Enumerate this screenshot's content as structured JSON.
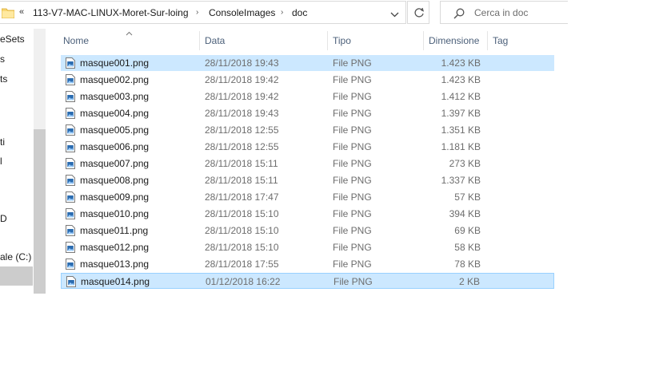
{
  "address": {
    "more": "«",
    "crumbs": [
      "113-V7-MAC-LINUX-Moret-Sur-loing",
      "ConsoleImages",
      "doc"
    ],
    "folder_icon": "folder-icon",
    "dropdown_icon": "chevron-down-icon",
    "refresh_icon": "refresh-icon"
  },
  "search": {
    "placeholder": "Cerca in doc",
    "icon": "search-icon"
  },
  "nav": {
    "items": [
      "eSets",
      "s",
      "ts",
      "ti",
      "l",
      "D",
      "ale (C:)"
    ]
  },
  "columns": {
    "name": "Nome",
    "date": "Data",
    "type": "Tipo",
    "size": "Dimensione",
    "tag": "Tag"
  },
  "files": [
    {
      "name": "masque001.png",
      "date": "28/11/2018 19:43",
      "type": "File PNG",
      "size": "1.423 KB"
    },
    {
      "name": "masque002.png",
      "date": "28/11/2018 19:42",
      "type": "File PNG",
      "size": "1.423 KB"
    },
    {
      "name": "masque003.png",
      "date": "28/11/2018 19:42",
      "type": "File PNG",
      "size": "1.412 KB"
    },
    {
      "name": "masque004.png",
      "date": "28/11/2018 19:43",
      "type": "File PNG",
      "size": "1.397 KB"
    },
    {
      "name": "masque005.png",
      "date": "28/11/2018 12:55",
      "type": "File PNG",
      "size": "1.351 KB"
    },
    {
      "name": "masque006.png",
      "date": "28/11/2018 12:55",
      "type": "File PNG",
      "size": "1.181 KB"
    },
    {
      "name": "masque007.png",
      "date": "28/11/2018 15:11",
      "type": "File PNG",
      "size": "273 KB"
    },
    {
      "name": "masque008.png",
      "date": "28/11/2018 15:11",
      "type": "File PNG",
      "size": "1.337 KB"
    },
    {
      "name": "masque009.png",
      "date": "28/11/2018 17:47",
      "type": "File PNG",
      "size": "57 KB"
    },
    {
      "name": "masque010.png",
      "date": "28/11/2018 15:10",
      "type": "File PNG",
      "size": "394 KB"
    },
    {
      "name": "masque011.png",
      "date": "28/11/2018 15:10",
      "type": "File PNG",
      "size": "69 KB"
    },
    {
      "name": "masque012.png",
      "date": "28/11/2018 15:10",
      "type": "File PNG",
      "size": "58 KB"
    },
    {
      "name": "masque013.png",
      "date": "28/11/2018 17:55",
      "type": "File PNG",
      "size": "78 KB"
    },
    {
      "name": "masque014.png",
      "date": "01/12/2018 16:22",
      "type": "File PNG",
      "size": "2 KB"
    }
  ],
  "colors": {
    "selection": "#cce8ff",
    "selection_border": "#99d1ff",
    "header_text": "#4c607a"
  }
}
